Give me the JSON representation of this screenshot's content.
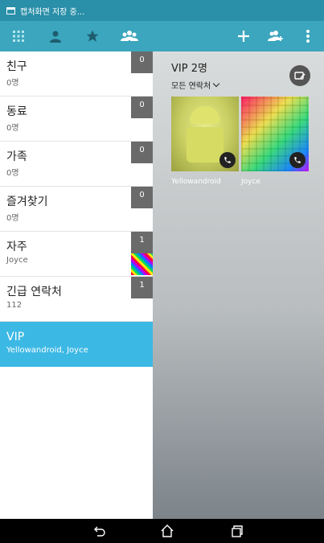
{
  "status_bar": {
    "notification_text": "캡처화면 저장 중..."
  },
  "toolbar": {
    "left_icons": [
      "dialpad-icon",
      "contacts-icon",
      "favorites-star-icon",
      "groups-icon"
    ],
    "right_icons": [
      "add-icon",
      "add-group-icon",
      "overflow-menu-icon"
    ]
  },
  "groups": [
    {
      "name": "친구",
      "sub": "0명",
      "count": "0"
    },
    {
      "name": "동료",
      "sub": "0명",
      "count": "0"
    },
    {
      "name": "가족",
      "sub": "0명",
      "count": "0"
    },
    {
      "name": "즐겨찾기",
      "sub": "0명",
      "count": "0"
    },
    {
      "name": "자주",
      "sub": "Joyce",
      "count": "1"
    },
    {
      "name": "긴급 연락처",
      "sub": "112",
      "count": "1"
    },
    {
      "name": "VIP",
      "sub": "Yellowandroid, Joyce",
      "count": ""
    }
  ],
  "detail": {
    "title": "VIP 2명",
    "filter_label": "모든 연락처",
    "members": [
      {
        "name": "Yellowandroid"
      },
      {
        "name": "Joyce"
      }
    ]
  },
  "nav": {
    "icons": [
      "back-icon",
      "home-icon",
      "recent-apps-icon"
    ]
  },
  "colors": {
    "status_bar": "#2a8fa8",
    "toolbar": "#3ba6bd",
    "selected_group": "#3cb8e4",
    "badge": "#6a6a6a"
  }
}
